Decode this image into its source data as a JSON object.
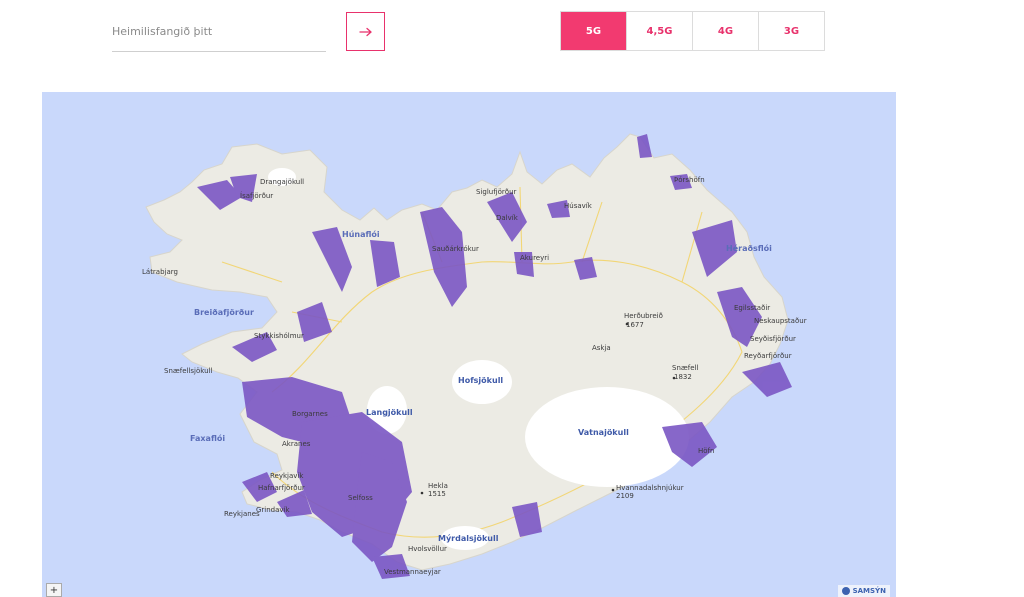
{
  "search": {
    "placeholder": "Heimilisfangið þitt",
    "submit_icon": "arrow-right-icon"
  },
  "network_tabs": [
    {
      "label": "5G",
      "active": true
    },
    {
      "label": "4,5G",
      "active": false
    },
    {
      "label": "4G",
      "active": false
    },
    {
      "label": "3G",
      "active": false
    }
  ],
  "colors": {
    "accent": "#f23a70",
    "sea": "#c9d8fb",
    "land": "#ecebe4",
    "coverage": "#7b57c4",
    "glacier": "#ffffff"
  },
  "map": {
    "water_labels": [
      "Húnaflói",
      "Breiðafjörður",
      "Faxaflói",
      "Héraðsflói"
    ],
    "glacier_labels": [
      "Hofsjökull",
      "Langjökull",
      "Vatnajökull",
      "Mýrdalsjökull"
    ],
    "places": [
      "Drangajökull",
      "Ísafjörður",
      "Látrabjarg",
      "Stykkishólmur",
      "Snæfellsjökull",
      "Borgarnes",
      "Akranes",
      "Reykjavík",
      "Hafnarfjörður",
      "Reykjanes",
      "Grindavík",
      "Sauðárkrókur",
      "Siglufjörður",
      "Dalvík",
      "Akureyri",
      "Húsavík",
      "Þórshöfn",
      "Egilsstaðir",
      "Seyðisfjörður",
      "Neskaupstaður",
      "Reyðarfjörður",
      "Askja",
      "Herðubreið",
      "1677",
      "Snæfell",
      "1832",
      "Höfn",
      "Hvannadalshnjúkur",
      "2109",
      "Hekla",
      "1515",
      "Selfoss",
      "Hvolsvöllur",
      "Vestmannaeyjar"
    ],
    "zoom_in_label": "+",
    "attribution": "SAMSÝN"
  }
}
